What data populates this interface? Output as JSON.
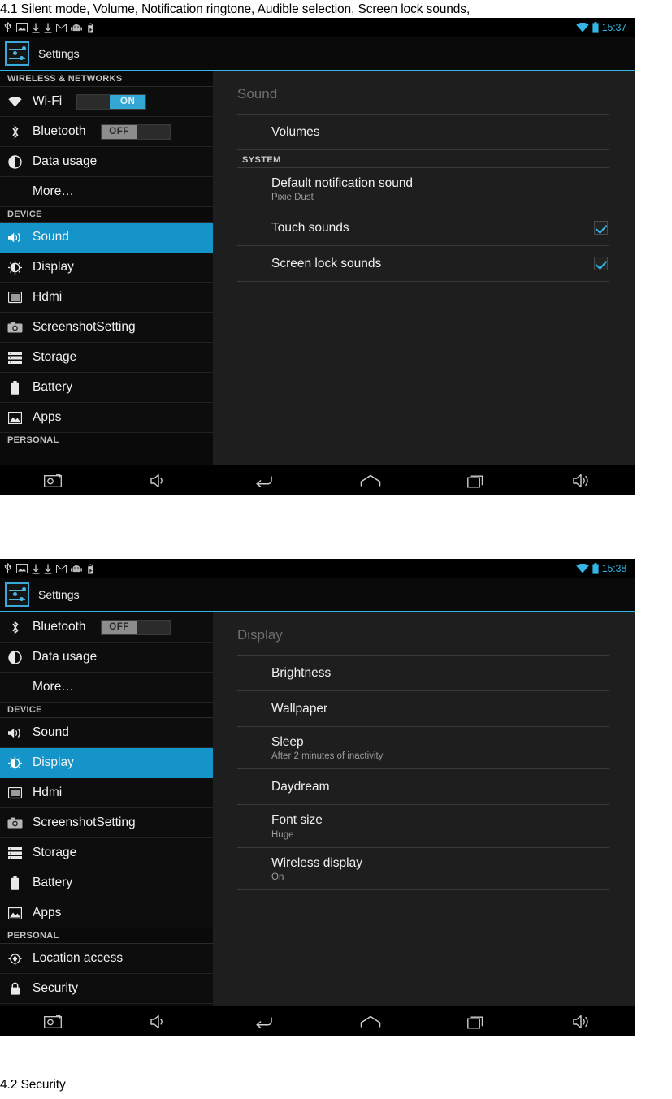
{
  "document": {
    "caption_top": "4.1 Silent mode, Volume, Notification ringtone, Audible selection, Screen lock sounds,",
    "caption_bottom": "4.2 Security"
  },
  "colors": {
    "accent": "#33b5e5",
    "selected_row": "#1494c8",
    "toggle_on": "#33a7d4",
    "toggle_off": "#8d8d8d",
    "screen_bg": "#0a0a0a",
    "content_bg": "#1e1e1e"
  },
  "screenshot_1": {
    "status_bar": {
      "left_icons": [
        "usb-icon",
        "screenshot-image-icon",
        "download-icon",
        "download-icon",
        "email-icon",
        "android-robot-icon",
        "play-store-icon"
      ],
      "wifi_icon": "wifi-icon",
      "battery_icon": "battery-icon",
      "time": "15:37"
    },
    "action_bar": {
      "app_icon": "settings-sliders-icon",
      "title": "Settings"
    },
    "sidebar": {
      "groups": [
        {
          "header": "WIRELESS & NETWORKS",
          "items": [
            {
              "label": "Wi-Fi",
              "icon": "wifi-icon",
              "toggle": "ON",
              "toggle_state": "on",
              "selected": false
            },
            {
              "label": "Bluetooth",
              "icon": "bluetooth-icon",
              "toggle": "OFF",
              "toggle_state": "off",
              "selected": false
            },
            {
              "label": "Data usage",
              "icon": "data-usage-icon",
              "selected": false
            },
            {
              "label": "More…",
              "icon": null,
              "selected": false
            }
          ]
        },
        {
          "header": "DEVICE",
          "items": [
            {
              "label": "Sound",
              "icon": "sound-icon",
              "selected": true
            },
            {
              "label": "Display",
              "icon": "display-icon",
              "selected": false
            },
            {
              "label": "Hdmi",
              "icon": "hdmi-icon",
              "selected": false
            },
            {
              "label": "ScreenshotSetting",
              "icon": "camera-icon",
              "selected": false
            },
            {
              "label": "Storage",
              "icon": "storage-icon",
              "selected": false
            },
            {
              "label": "Battery",
              "icon": "battery-icon",
              "selected": false
            },
            {
              "label": "Apps",
              "icon": "apps-icon",
              "selected": false
            }
          ]
        },
        {
          "header": "PERSONAL",
          "items": []
        }
      ]
    },
    "content": {
      "title": "Sound",
      "rows": [
        {
          "kind": "pref",
          "title": "Volumes",
          "sub": null,
          "checkbox": false
        },
        {
          "kind": "section",
          "title": "SYSTEM"
        },
        {
          "kind": "pref",
          "title": "Default notification sound",
          "sub": "Pixie Dust",
          "checkbox": false
        },
        {
          "kind": "pref",
          "title": "Touch sounds",
          "sub": null,
          "checkbox": true,
          "checked": true
        },
        {
          "kind": "pref",
          "title": "Screen lock sounds",
          "sub": null,
          "checkbox": true,
          "checked": true
        }
      ]
    },
    "nav_bar": {
      "buttons": [
        "screenshot-capture-icon",
        "volume-down-icon",
        "back-icon",
        "home-icon",
        "recents-icon",
        "volume-up-icon"
      ]
    }
  },
  "screenshot_2": {
    "status_bar": {
      "left_icons": [
        "usb-icon",
        "screenshot-image-icon",
        "download-icon",
        "download-icon",
        "email-icon",
        "android-robot-icon",
        "play-store-icon"
      ],
      "wifi_icon": "wifi-icon",
      "battery_icon": "battery-icon",
      "time": "15:38"
    },
    "action_bar": {
      "app_icon": "settings-sliders-icon",
      "title": "Settings"
    },
    "sidebar": {
      "groups": [
        {
          "header": null,
          "items": [
            {
              "label": "Bluetooth",
              "icon": "bluetooth-icon",
              "toggle": "OFF",
              "toggle_state": "off",
              "selected": false
            },
            {
              "label": "Data usage",
              "icon": "data-usage-icon",
              "selected": false
            },
            {
              "label": "More…",
              "icon": null,
              "selected": false
            }
          ]
        },
        {
          "header": "DEVICE",
          "items": [
            {
              "label": "Sound",
              "icon": "sound-icon",
              "selected": false
            },
            {
              "label": "Display",
              "icon": "display-icon",
              "selected": true
            },
            {
              "label": "Hdmi",
              "icon": "hdmi-icon",
              "selected": false
            },
            {
              "label": "ScreenshotSetting",
              "icon": "camera-icon",
              "selected": false
            },
            {
              "label": "Storage",
              "icon": "storage-icon",
              "selected": false
            },
            {
              "label": "Battery",
              "icon": "battery-icon",
              "selected": false
            },
            {
              "label": "Apps",
              "icon": "apps-icon",
              "selected": false
            }
          ]
        },
        {
          "header": "PERSONAL",
          "items": [
            {
              "label": "Location access",
              "icon": "location-icon",
              "selected": false
            },
            {
              "label": "Security",
              "icon": "lock-icon",
              "selected": false
            }
          ]
        }
      ]
    },
    "content": {
      "title": "Display",
      "rows": [
        {
          "kind": "pref",
          "title": "Brightness",
          "sub": null,
          "checkbox": false
        },
        {
          "kind": "pref",
          "title": "Wallpaper",
          "sub": null,
          "checkbox": false
        },
        {
          "kind": "pref",
          "title": "Sleep",
          "sub": "After 2 minutes of inactivity",
          "checkbox": false
        },
        {
          "kind": "pref",
          "title": "Daydream",
          "sub": null,
          "checkbox": false
        },
        {
          "kind": "pref",
          "title": "Font size",
          "sub": "Huge",
          "checkbox": false
        },
        {
          "kind": "pref",
          "title": "Wireless display",
          "sub": "On",
          "checkbox": false
        }
      ]
    },
    "nav_bar": {
      "buttons": [
        "screenshot-capture-icon",
        "volume-down-icon",
        "back-icon",
        "home-icon",
        "recents-icon",
        "volume-up-icon"
      ]
    }
  }
}
